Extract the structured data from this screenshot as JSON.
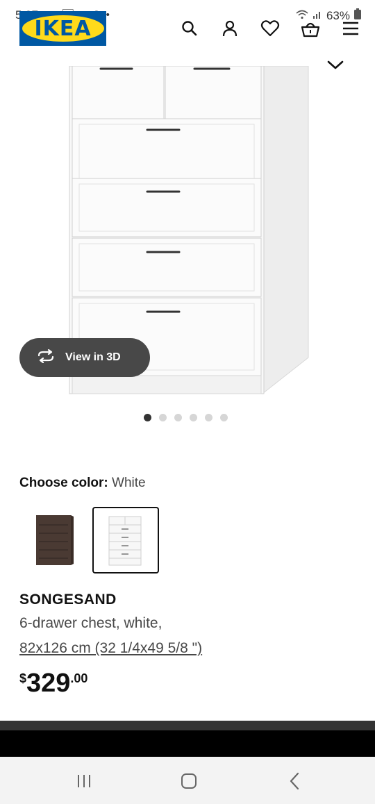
{
  "status_bar": {
    "time": "5:27",
    "notification_icons": "🖼 S © •",
    "battery": "63%"
  },
  "header": {
    "logo_text": "IKEA",
    "icons": [
      "search-icon",
      "user-icon",
      "heart-icon",
      "basket-icon",
      "menu-icon"
    ]
  },
  "gallery": {
    "view3d_label": "View in 3D",
    "dot_count": 6,
    "active_dot": 1
  },
  "color_picker": {
    "label": "Choose color:",
    "value": "White",
    "options": [
      "brown",
      "white"
    ]
  },
  "product": {
    "name": "SONGESAND",
    "description": "6-drawer chest, white,",
    "size": "82x126 cm (32 1/4x49 5/8 \")",
    "price_currency": "$",
    "price_whole": "329",
    "price_decimal": ".00"
  },
  "colors": {
    "ikea_blue": "#0058a3",
    "ikea_yellow": "#ffda1a",
    "button_dark": "#484848"
  }
}
